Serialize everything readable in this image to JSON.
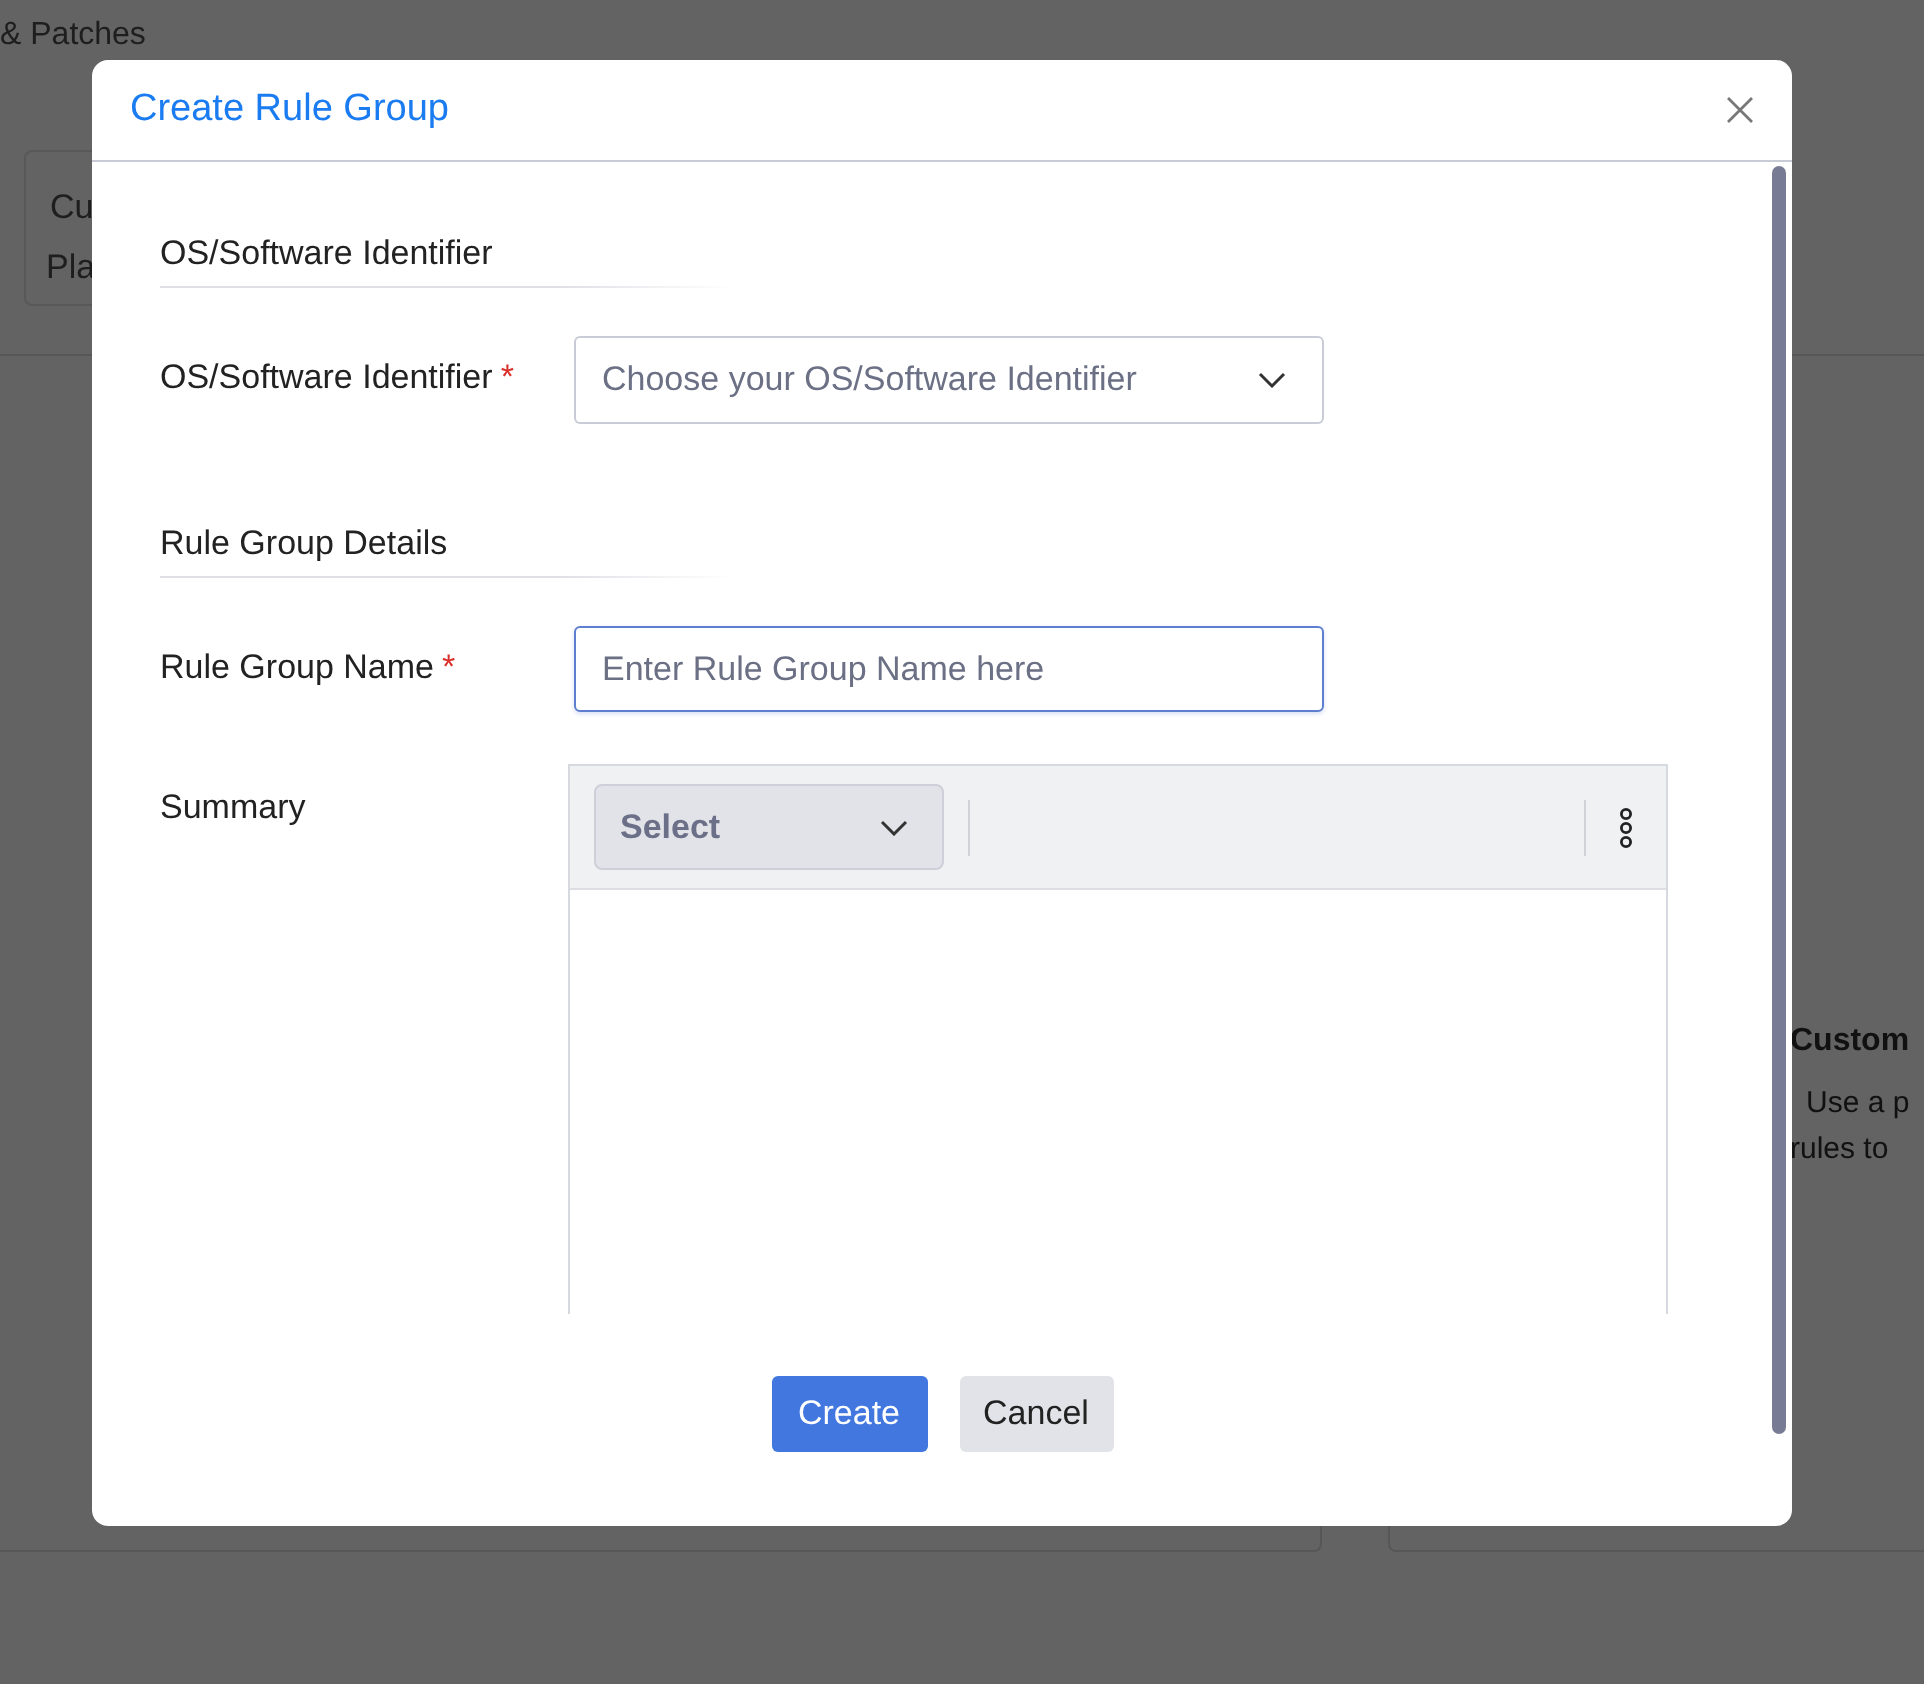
{
  "background": {
    "breadcrumb": "& Patches",
    "left_card": [
      "Cu",
      "Pla"
    ],
    "right_card": {
      "title": "Custom",
      "lines": [
        "Use a p",
        "rules to"
      ]
    }
  },
  "dialog": {
    "title": "Create Rule Group",
    "sections": [
      {
        "heading": "OS/Software Identifier",
        "fields": [
          {
            "kind": "select",
            "label": "OS/Software Identifier",
            "required_mark": "*",
            "placeholder": "Choose your OS/Software Identifier"
          }
        ]
      },
      {
        "heading": "Rule Group Details",
        "fields": [
          {
            "kind": "text",
            "label": "Rule Group Name",
            "required_mark": "*",
            "placeholder": "Enter Rule Group Name here",
            "focused": true
          },
          {
            "kind": "editor",
            "label": "Summary",
            "toolbar_select": "Select"
          }
        ]
      }
    ],
    "buttons": [
      {
        "label": "Create",
        "kind": "primary"
      },
      {
        "label": "Cancel",
        "kind": "secondary"
      }
    ]
  }
}
